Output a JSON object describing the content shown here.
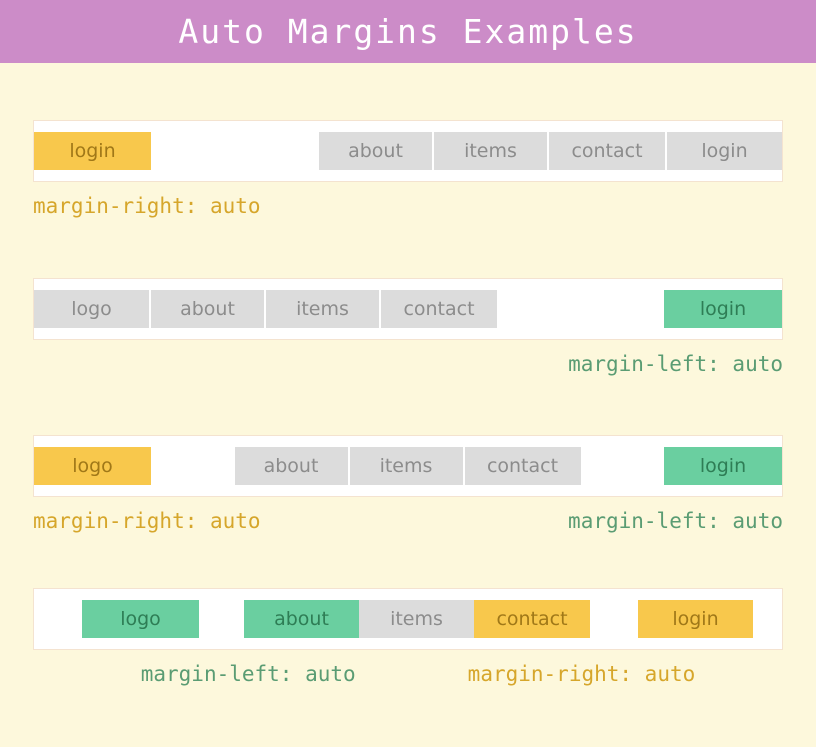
{
  "header": {
    "title": "Auto Margins Examples",
    "background": "#CC8CC8",
    "text_color": "#FFFFFF"
  },
  "page": {
    "background": "#FDF8DC"
  },
  "colors": {
    "gray_item_bg": "#DCDCDC",
    "gray_item_text": "#8C8C8C",
    "yellow_item_bg": "#F8C84C",
    "yellow_item_text": "#A07818",
    "green_item_bg": "#6ACFA0",
    "green_item_text": "#2E7D55",
    "caption_yellow": "#D6A62B",
    "caption_green": "#5A9C73",
    "navbar_bg": "#FFFFFF",
    "navbar_border": "#F4E3D0"
  },
  "examples": [
    {
      "id": "example-1",
      "items": [
        {
          "label": "login",
          "color": "yellow",
          "group": "left"
        },
        {
          "label": "about",
          "color": "gray",
          "group": "right"
        },
        {
          "label": "items",
          "color": "gray",
          "group": "right"
        },
        {
          "label": "contact",
          "color": "gray",
          "group": "right"
        },
        {
          "label": "login",
          "color": "gray",
          "group": "right"
        }
      ],
      "captions": [
        {
          "text": "margin-right: auto",
          "color": "yellow",
          "align": "left"
        }
      ]
    },
    {
      "id": "example-2",
      "items": [
        {
          "label": "logo",
          "color": "gray",
          "group": "left"
        },
        {
          "label": "about",
          "color": "gray",
          "group": "left"
        },
        {
          "label": "items",
          "color": "gray",
          "group": "left"
        },
        {
          "label": "contact",
          "color": "gray",
          "group": "left"
        },
        {
          "label": "login",
          "color": "green",
          "group": "right"
        }
      ],
      "captions": [
        {
          "text": "margin-left: auto",
          "color": "green",
          "align": "right"
        }
      ]
    },
    {
      "id": "example-3",
      "items": [
        {
          "label": "logo",
          "color": "yellow",
          "group": "left"
        },
        {
          "label": "about",
          "color": "gray",
          "group": "center"
        },
        {
          "label": "items",
          "color": "gray",
          "group": "center"
        },
        {
          "label": "contact",
          "color": "gray",
          "group": "center"
        },
        {
          "label": "login",
          "color": "green",
          "group": "right"
        }
      ],
      "captions": [
        {
          "text": "margin-right: auto",
          "color": "yellow",
          "align": "left"
        },
        {
          "text": "margin-left: auto",
          "color": "green",
          "align": "right"
        }
      ]
    },
    {
      "id": "example-4",
      "items": [
        {
          "label": "logo",
          "color": "green",
          "group": "center"
        },
        {
          "label": "about",
          "color": "green",
          "group": "center"
        },
        {
          "label": "items",
          "color": "gray",
          "group": "center"
        },
        {
          "label": "contact",
          "color": "yellow",
          "group": "center"
        },
        {
          "label": "login",
          "color": "yellow",
          "group": "center"
        }
      ],
      "captions": [
        {
          "text": "margin-left: auto",
          "color": "green",
          "align": "center"
        },
        {
          "text": "margin-right: auto",
          "color": "yellow",
          "align": "center"
        }
      ]
    }
  ]
}
